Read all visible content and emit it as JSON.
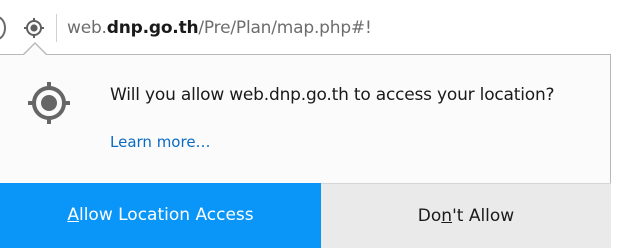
{
  "urlbar": {
    "url_prefix": "web.",
    "url_host": "dnp.go.th",
    "url_path": "/Pre/Plan/map.php#!",
    "location_icon": "location-crosshair-icon"
  },
  "doorhanger": {
    "icon": "location-crosshair-icon",
    "message": "Will you allow web.dnp.go.th to access your location?",
    "learn_more": "Learn more…",
    "allow_button": {
      "accesskey": "A",
      "rest": "llow Location Access"
    },
    "deny_button": {
      "before": "Do",
      "accesskey": "n",
      "after": "'t Allow"
    }
  },
  "colors": {
    "primary_button": "#0996f8",
    "secondary_button": "#eaeaea",
    "link": "#0a6bc4"
  }
}
